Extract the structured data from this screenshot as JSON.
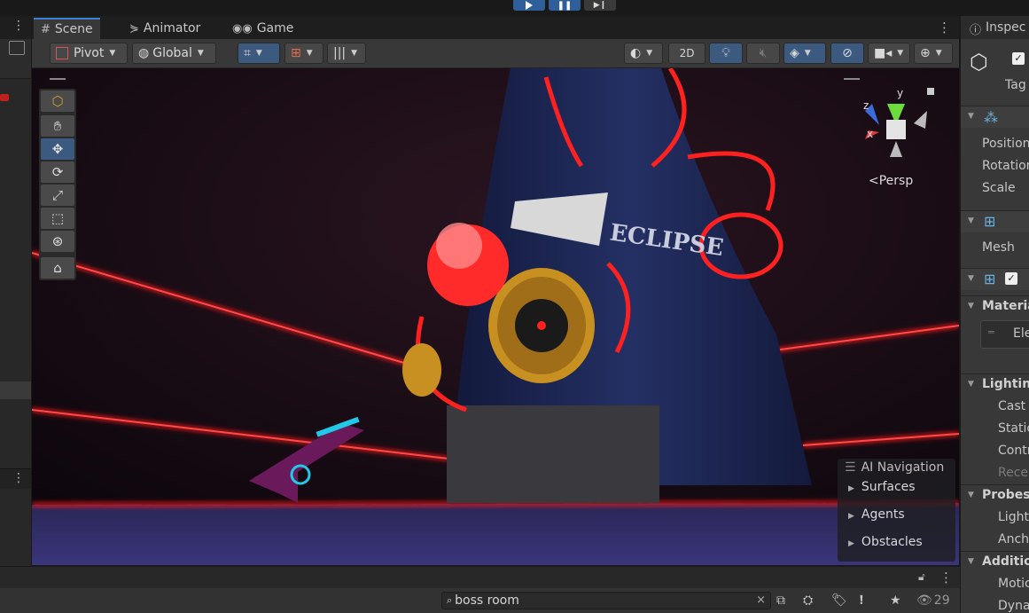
{
  "scene_tabs": [
    {
      "label": "Scene",
      "icon": "grid-icon"
    },
    {
      "label": "Animator",
      "icon": "animator-icon"
    },
    {
      "label": "Game",
      "icon": "gamepad-icon"
    }
  ],
  "toolbar": {
    "pivot_label": "Pivot",
    "global_label": "Global",
    "twod_label": "2D"
  },
  "viewport": {
    "persp_label": "Persp",
    "sign_text": "ECLIPSE",
    "gizmo_axes": {
      "y": "y",
      "z": "z",
      "x": "x"
    }
  },
  "ai_navigation": {
    "title": "AI Navigation",
    "items": [
      "Surfaces",
      "Agents",
      "Obstacles"
    ]
  },
  "inspector": {
    "tab_label": "Inspec",
    "tag_label": "Tag",
    "transform_rows": [
      "Position",
      "Rotation",
      "Scale"
    ],
    "mesh_label": "Mesh",
    "materials_label": "Materia",
    "element_label": "Ele",
    "lighting_label": "Lighting",
    "lighting_rows": [
      "Cast",
      "Static",
      "Contr",
      "Rece"
    ],
    "probes_label": "Probes",
    "probes_rows": [
      "Light",
      "Anch"
    ],
    "additional_label": "Additio",
    "additional_rows": [
      "Motic",
      "Dyna"
    ]
  },
  "search": {
    "value": "boss room",
    "hidden_count": "29"
  },
  "colors": {
    "accent": "#3b82d6",
    "laser": "#ff1a1a",
    "toggle_blue": "#3c5a80"
  }
}
